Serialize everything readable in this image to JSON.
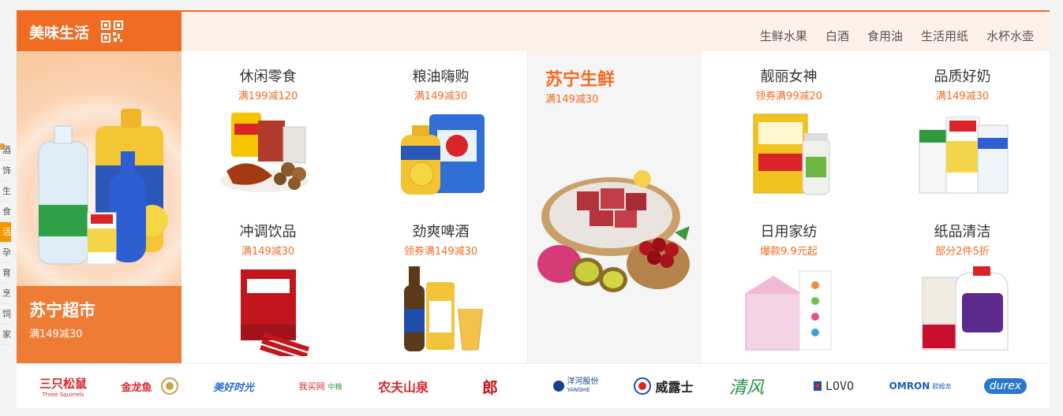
{
  "floor": {
    "brand_title": "美味生活",
    "subnav": [
      "生鲜水果",
      "白酒",
      "食用油",
      "生活用纸",
      "水杯水壶"
    ]
  },
  "hero": {
    "title": "苏宁超市",
    "subtitle": "满149减30"
  },
  "fresh": {
    "title": "苏宁生鲜",
    "subtitle": "满149减30"
  },
  "cells": [
    {
      "title": "休闲零食",
      "subtitle": "满199减120",
      "icon": "snacks-image"
    },
    {
      "title": "粮油嗨购",
      "subtitle": "满149减30",
      "icon": "rice-oil-image"
    },
    {
      "title": "靓丽女神",
      "subtitle": "领券满99减20",
      "icon": "beauty-supplement-image"
    },
    {
      "title": "品质好奶",
      "subtitle": "满149减30",
      "icon": "milk-image"
    },
    {
      "title": "冲调饮品",
      "subtitle": "满149减30",
      "icon": "coffee-image"
    },
    {
      "title": "劲爽啤酒",
      "subtitle": "领券满149减30",
      "icon": "beer-image"
    },
    {
      "title": "日用家纺",
      "subtitle": "爆款9.9元起",
      "icon": "home-textile-image"
    },
    {
      "title": "纸品清洁",
      "subtitle": "部分2件5折",
      "icon": "detergent-image"
    }
  ],
  "brands": [
    {
      "name": "三只松鼠",
      "sub": "Three Squirrels",
      "color": "#d8262a"
    },
    {
      "name": "金龙鱼",
      "color": "#d8262a"
    },
    {
      "name": "美好时光",
      "color": "#2a6dd1"
    },
    {
      "name": "我买网",
      "sub": "中粮",
      "color": "#d8262a"
    },
    {
      "name": "农夫山泉",
      "color": "#d8262a"
    },
    {
      "name": "郎",
      "color": "#c7151c"
    },
    {
      "name": "洋河股份",
      "sub": "YANGHE",
      "color": "#1a3f8c"
    },
    {
      "name": "威露士",
      "color": "#222"
    },
    {
      "name": "清风",
      "color": "#1f8f3e"
    },
    {
      "name": "LOVO",
      "color": "#333"
    },
    {
      "name": "OMRON",
      "sub": "欧姆龙",
      "color": "#1a5fb4"
    },
    {
      "name": "durex",
      "color": "#fff",
      "bg": "#2a79c8"
    }
  ],
  "sidenav": [
    "酒",
    "饰",
    "生",
    "食",
    "活",
    "孕",
    "育",
    "烹",
    "饲",
    "家"
  ],
  "accent": "#ef6c22"
}
